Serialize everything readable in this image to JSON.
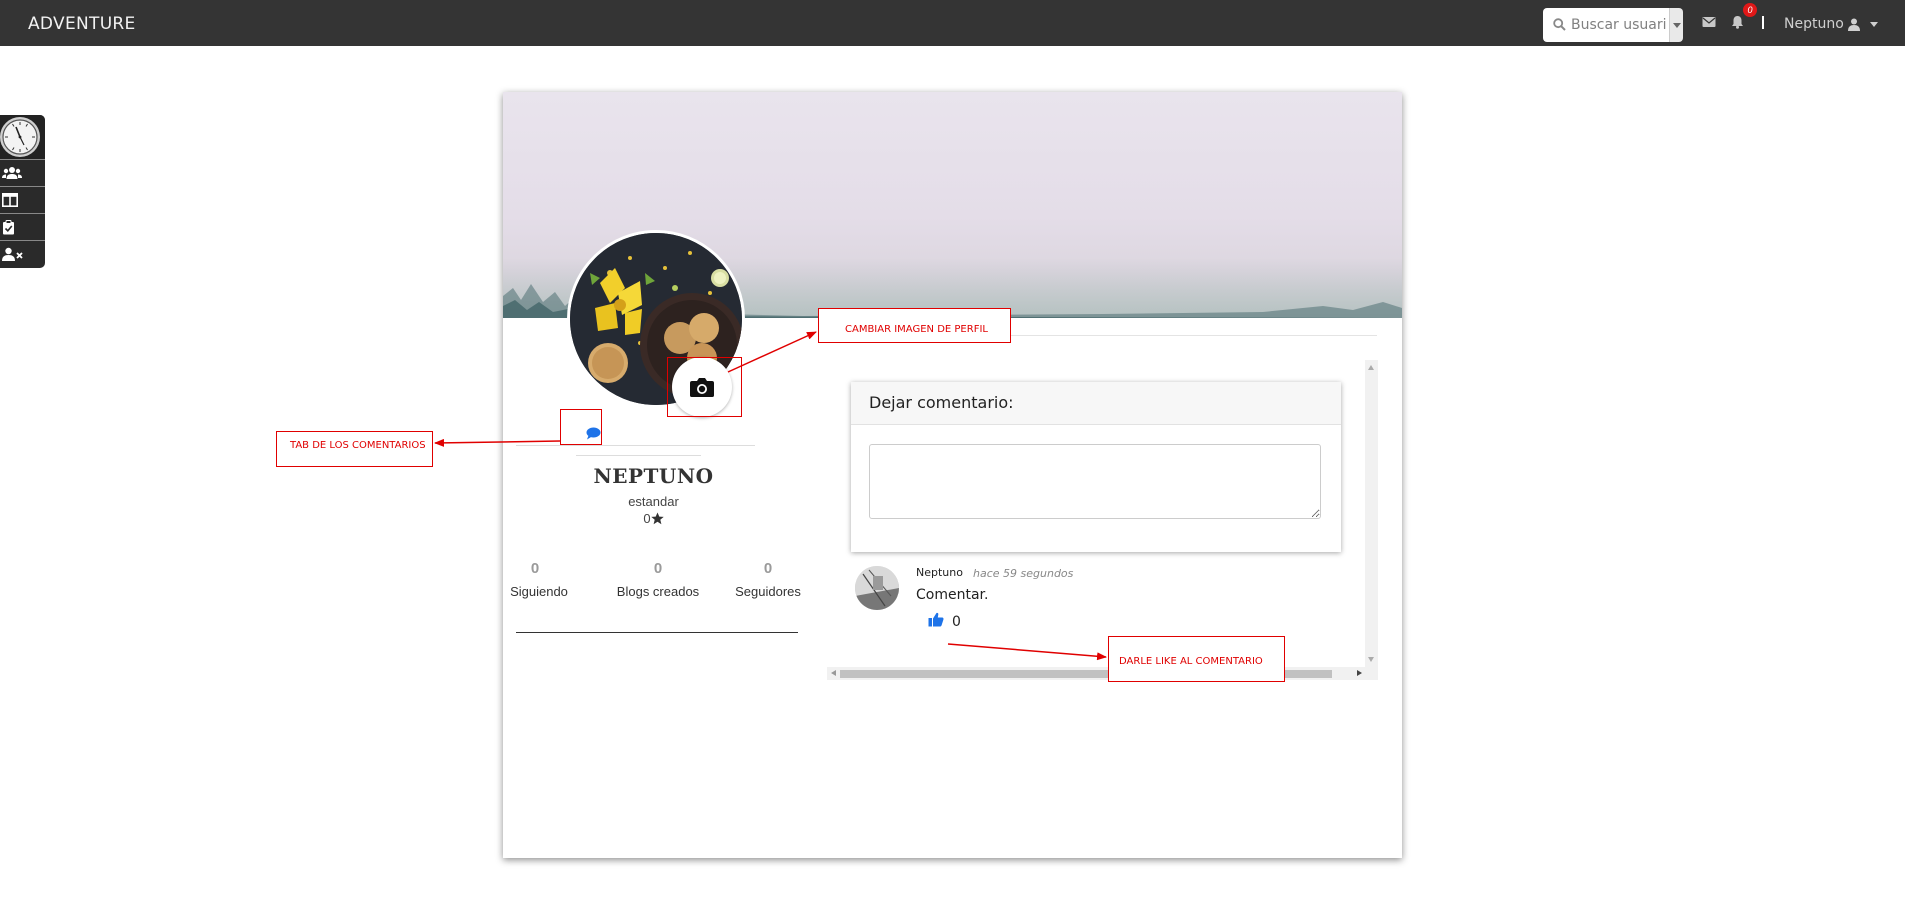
{
  "navbar": {
    "brand": "ADVENTURE",
    "search_placeholder": "Buscar usuario",
    "notification_count": "0",
    "username": "Neptuno",
    "icons": [
      "search-icon",
      "envelope-icon",
      "bell-icon",
      "user-icon",
      "chevron-down-icon"
    ]
  },
  "sidebar": {
    "items": [
      {
        "icon": "clock-icon"
      },
      {
        "icon": "users-icon"
      },
      {
        "icon": "columns-icon"
      },
      {
        "icon": "clipboard-check-icon"
      },
      {
        "icon": "user-times-icon"
      }
    ]
  },
  "profile": {
    "name": "NEPTUNO",
    "role": "estandar",
    "stars": "0",
    "stats": [
      {
        "value": "0",
        "label": "Siguiendo"
      },
      {
        "value": "0",
        "label": "Blogs creados"
      },
      {
        "value": "0",
        "label": "Seguidores"
      }
    ]
  },
  "comment_form": {
    "title": "Dejar comentario:",
    "textarea_value": ""
  },
  "comments": [
    {
      "author": "Neptuno",
      "time": "hace 59 segundos",
      "text": "Comentar.",
      "likes": "0"
    }
  ],
  "annotations": {
    "change_image": "CAMBIAR IMAGEN DE PERFIL",
    "comments_tab": "TAB DE LOS COMENTARIOS",
    "like_comment": "DARLE LIKE AL COMENTARIO"
  },
  "colors": {
    "navbar_bg": "#343434",
    "accent_blue": "#1e73e8",
    "annotation_red": "#e00000",
    "badge_red": "#e01818"
  }
}
